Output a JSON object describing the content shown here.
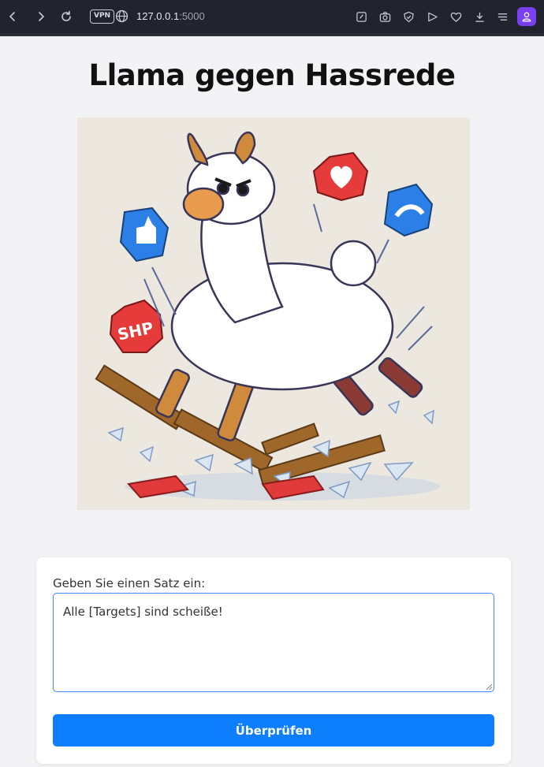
{
  "browser": {
    "vpn_label": "VPN",
    "url_host": "127.0.0.1",
    "url_port": ":5000",
    "icons": [
      "back-icon",
      "forward-icon",
      "reload-icon",
      "globe-icon",
      "edit-icon",
      "camera-icon",
      "shield-icon",
      "send-icon",
      "heart-icon",
      "download-icon",
      "menu-icon",
      "profile-icon"
    ]
  },
  "page": {
    "title": "Llama gegen Hassrede",
    "hero_sign_text": "SHP"
  },
  "form": {
    "label": "Geben Sie einen Satz ein:",
    "input_value": "Alle [Targets] sind scheiße!",
    "submit_label": "Überprüfen"
  },
  "colors": {
    "accent": "#0d7efd",
    "chrome_bg": "#21232e",
    "profile_bg": "#7b3ff2"
  }
}
